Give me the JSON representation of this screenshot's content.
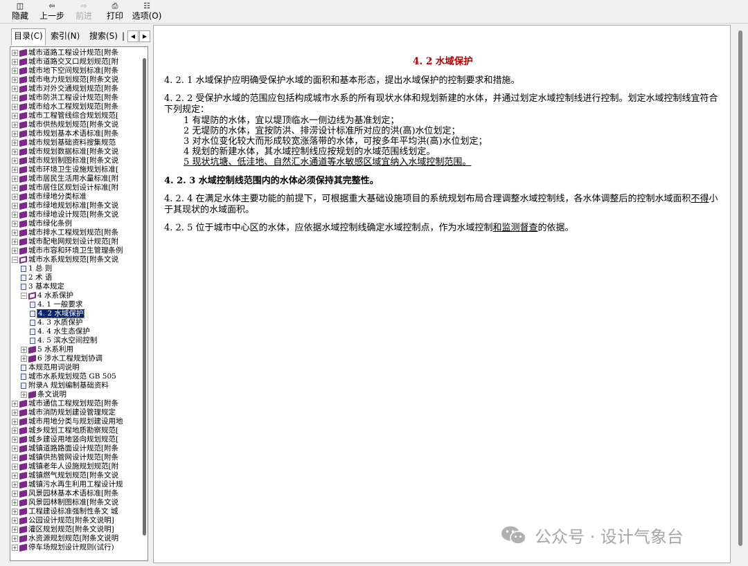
{
  "toolbar": {
    "hide": "隐藏",
    "back": "上一步",
    "forward": "前进",
    "print": "打印",
    "options": "选项(O)"
  },
  "tabs": {
    "contents": "目录(C)",
    "index": "索引(N)",
    "search": "搜索(S)"
  },
  "tree": [
    {
      "label": "城市道路工程设计规范[附条",
      "type": "book",
      "level": 0
    },
    {
      "label": "城市道路交叉口规划规范[附",
      "type": "book",
      "level": 0
    },
    {
      "label": "城市地下空间规划标准[附条",
      "type": "book",
      "level": 0
    },
    {
      "label": "城市电力规划规范[附条文说",
      "type": "book",
      "level": 0
    },
    {
      "label": "城市对外交通规划规范[附条",
      "type": "book",
      "level": 0
    },
    {
      "label": "城市防洪工程设计规范[附条",
      "type": "book",
      "level": 0
    },
    {
      "label": "城市给水工程规划规范[附条",
      "type": "book",
      "level": 0
    },
    {
      "label": "城市工程管线综合规划规范[",
      "type": "book",
      "level": 0
    },
    {
      "label": "城市供热规划规范[附条文说",
      "type": "book",
      "level": 0
    },
    {
      "label": "城市规划基本术语标准[附条",
      "type": "book",
      "level": 0
    },
    {
      "label": "城市规划基础资料搜集规范",
      "type": "book",
      "level": 0
    },
    {
      "label": "城市规划数据标准[附条文说",
      "type": "book",
      "level": 0
    },
    {
      "label": "城市规划制图标准[附条文说",
      "type": "book",
      "level": 0
    },
    {
      "label": "城市环境卫生设施规划标准[",
      "type": "book",
      "level": 0
    },
    {
      "label": "城市居民生活用水量标准[附",
      "type": "book",
      "level": 0
    },
    {
      "label": "城市居住区规划设计标准[附",
      "type": "book",
      "level": 0
    },
    {
      "label": "城市绿地分类标准",
      "type": "book",
      "level": 0
    },
    {
      "label": "城市绿地规划标准[附条文说",
      "type": "book",
      "level": 0
    },
    {
      "label": "城市绿地设计规范[附条文说",
      "type": "book",
      "level": 0
    },
    {
      "label": "城市绿化条例",
      "type": "book",
      "level": 0
    },
    {
      "label": "城市排水工程规划规范[附条",
      "type": "book",
      "level": 0
    },
    {
      "label": "城市配电网规划设计规范[附",
      "type": "book",
      "level": 0
    },
    {
      "label": "城市市容和环境卫生管理条例",
      "type": "book",
      "level": 0
    },
    {
      "label": "城市水系规划规范[附条文说",
      "type": "openbook",
      "level": 0
    },
    {
      "label": "1 总  则",
      "type": "page",
      "level": 1
    },
    {
      "label": "2 术  语",
      "type": "page",
      "level": 1
    },
    {
      "label": "3 基本规定",
      "type": "page",
      "level": 1
    },
    {
      "label": "4 水系保护",
      "type": "openbook",
      "level": 1
    },
    {
      "label": "4. 1 一般要求",
      "type": "page",
      "level": 2
    },
    {
      "label": "4. 2 水域保护",
      "type": "page",
      "level": 2,
      "selected": true
    },
    {
      "label": "4. 3 水质保护",
      "type": "page",
      "level": 2
    },
    {
      "label": "4. 4 水生态保护",
      "type": "page",
      "level": 2
    },
    {
      "label": "4. 5 滨水空间控制",
      "type": "page",
      "level": 2
    },
    {
      "label": "5 水系利用",
      "type": "book",
      "level": 1
    },
    {
      "label": "6 涉水工程规划协调",
      "type": "book",
      "level": 1
    },
    {
      "label": "本规范用词说明",
      "type": "page",
      "level": 1
    },
    {
      "label": "城市水系规划规范 GB 505",
      "type": "page",
      "level": 1
    },
    {
      "label": "附录A 规划编制基础资料",
      "type": "page",
      "level": 1
    },
    {
      "label": "条文说明",
      "type": "book",
      "level": 1
    },
    {
      "label": "城市通信工程规划规范[附条",
      "type": "book",
      "level": 0
    },
    {
      "label": "城市消防规划建设管理规定",
      "type": "book",
      "level": 0
    },
    {
      "label": "城市用地分类与规划建设用地",
      "type": "book",
      "level": 0
    },
    {
      "label": "城乡规划工程地质勘察规范[",
      "type": "book",
      "level": 0
    },
    {
      "label": "城乡建设用地竖向规划规范[",
      "type": "book",
      "level": 0
    },
    {
      "label": "城镇道路路面设计规范[附条",
      "type": "book",
      "level": 0
    },
    {
      "label": "城镇供热管网设计规范[附条",
      "type": "book",
      "level": 0
    },
    {
      "label": "城镇老年人设施规划规范[附",
      "type": "book",
      "level": 0
    },
    {
      "label": "城镇燃气规划规范[附条文说",
      "type": "book",
      "level": 0
    },
    {
      "label": "城镇污水再生利用工程设计规",
      "type": "book",
      "level": 0
    },
    {
      "label": "风景园林基本术语标准[附条",
      "type": "book",
      "level": 0
    },
    {
      "label": "风景园林制图标准[附条文说",
      "type": "book",
      "level": 0
    },
    {
      "label": "工程建设标准强制性条文 城",
      "type": "book",
      "level": 0
    },
    {
      "label": "公园设计规范[附条文说明]",
      "type": "book",
      "level": 0
    },
    {
      "label": "灌区规划规范[附条文说明]",
      "type": "book",
      "level": 0
    },
    {
      "label": "水资源规划规范[附条文说明",
      "type": "book",
      "level": 0
    },
    {
      "label": "停车场规划设计规则(试行)",
      "type": "book",
      "level": 0
    }
  ],
  "doc": {
    "title": "4. 2 水域保护",
    "p1": "4. 2. 1 水域保护应明确受保护水域的面积和基本形态，提出水域保护的控制要求和措施。",
    "p2": "4. 2. 2 受保护水域的范围应包括构成城市水系的所有现状水体和规划新建的水体，并通过划定水域控制线进行控制。划定水域控制线宜符合下列规定：",
    "items": [
      "1 有堤防的水体，宜以堤顶临水一侧边线为基准划定；",
      "2 无堤防的水体，宜按防洪、排涝设计标准所对应的洪(高)水位划定；",
      "3 对水位变化较大而形成较宽涨落带的水体，可按多年平均洪(高)水位划定；",
      "4 规划的新建水体，其水域控制线应按规划的水域范围线划定。",
      "5 现状坑塘、低洼地、自然汇水通道等水敏感区域宜纳入水域控制范围。"
    ],
    "p3": "4. 2. 3 水域控制线范围内的水体必须保持其完整性。",
    "p4_a": "4. 2. 4 在满足水体主要功能的前提下，可根据重大基础设施项目的系统规划布局合理调整水域控制线，各水体调整后的控制水域面积",
    "p4_u": "不得",
    "p4_b": "小于其现状的水域面积。",
    "p5_a": "4. 2. 5 位于城市中心区的水体，应依据水域控制线确定水域控制点，作为水域控制",
    "p5_u": "和监测督查",
    "p5_b": "的依据。"
  },
  "watermark": {
    "text": "公众号 · 设计气象台"
  }
}
